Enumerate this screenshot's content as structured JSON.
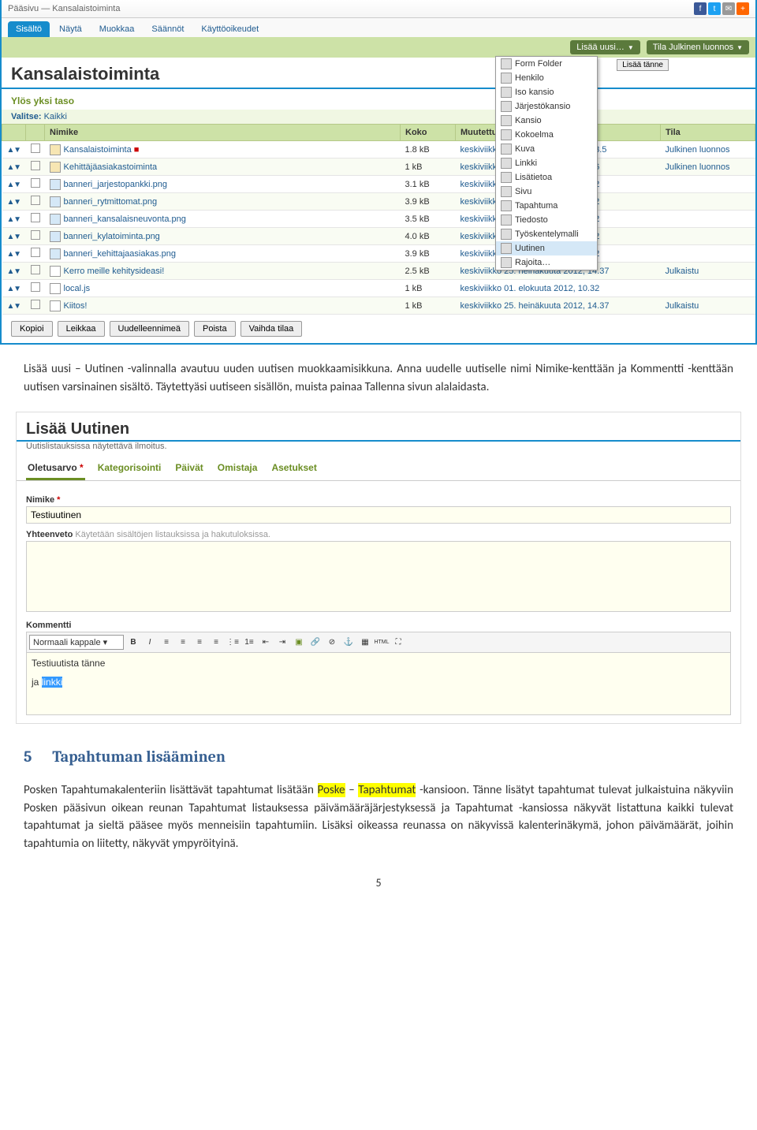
{
  "screenshot1": {
    "breadcrumb": {
      "root": "Pääsivu",
      "sep": "—",
      "current": "Kansalaistoiminta"
    },
    "tabs": [
      "Sisältö",
      "Näytä",
      "Muokkaa",
      "Säännöt",
      "Käyttöoikeudet"
    ],
    "green_buttons": {
      "add_new": "Lisää uusi…",
      "state": "Tila Julkinen luonnos"
    },
    "add_here_btn": "Lisää tänne",
    "dropdown_items": [
      {
        "icon": "form-icon",
        "label": "Form Folder"
      },
      {
        "icon": "person-icon",
        "label": "Henkilo"
      },
      {
        "icon": "folder-icon",
        "label": "Iso kansio"
      },
      {
        "icon": "folder-icon",
        "label": "Järjestökansio"
      },
      {
        "icon": "folder-icon",
        "label": "Kansio"
      },
      {
        "icon": "collection-icon",
        "label": "Kokoelma"
      },
      {
        "icon": "image-icon",
        "label": "Kuva"
      },
      {
        "icon": "link-icon",
        "label": "Linkki"
      },
      {
        "icon": "info-icon",
        "label": "Lisätietoa"
      },
      {
        "icon": "page-icon",
        "label": "Sivu"
      },
      {
        "icon": "event-icon",
        "label": "Tapahtuma"
      },
      {
        "icon": "file-icon",
        "label": "Tiedosto"
      },
      {
        "icon": "template-icon",
        "label": "Työskentelymalli"
      },
      {
        "icon": "news-icon",
        "label": "Uutinen",
        "selected": true
      },
      {
        "icon": "",
        "label": "Rajoita…"
      }
    ],
    "page_title": "Kansalaistoiminta",
    "up_link": "Ylös yksi taso",
    "select_label": "Valitse:",
    "select_all": "Kaikki",
    "columns": {
      "name": "Nimike",
      "size": "Koko",
      "modified": "Muutettu",
      "state": "Tila"
    },
    "rows": [
      {
        "icon": "folder",
        "name": "Kansalaistoiminta",
        "mark": "■",
        "size": "1.8 kB",
        "modified": "keskiviikko 09. tammikuuta 2013, 13.5",
        "state": "Julkinen luonnos"
      },
      {
        "icon": "folder",
        "name": "Kehittäjäasiakastoiminta",
        "size": "1 kB",
        "modified": "keskiviikko 29. elokuuta 2012, 14.16",
        "state": "Julkinen luonnos"
      },
      {
        "icon": "img",
        "name": "banneri_jarjestopankki.png",
        "size": "3.1 kB",
        "modified": "keskiviikko 01. elokuuta 2012, 10.32",
        "state": ""
      },
      {
        "icon": "img",
        "name": "banneri_rytmittomat.png",
        "size": "3.9 kB",
        "modified": "keskiviikko 01. elokuuta 2012, 10.32",
        "state": ""
      },
      {
        "icon": "img",
        "name": "banneri_kansalaisneuvonta.png",
        "size": "3.5 kB",
        "modified": "keskiviikko 01. elokuuta 2012, 10.32",
        "state": ""
      },
      {
        "icon": "img",
        "name": "banneri_kylatoiminta.png",
        "size": "4.0 kB",
        "modified": "keskiviikko 01. elokuuta 2012, 10.32",
        "state": ""
      },
      {
        "icon": "img",
        "name": "banneri_kehittajaasiakas.png",
        "size": "3.9 kB",
        "modified": "keskiviikko 01. elokuuta 2012, 10.32",
        "state": ""
      },
      {
        "icon": "doc",
        "name": "Kerro meille kehitysideasi!",
        "size": "2.5 kB",
        "modified": "keskiviikko 25. heinäkuuta 2012, 14.37",
        "state": "Julkaistu"
      },
      {
        "icon": "js",
        "name": "local.js",
        "size": "1 kB",
        "modified": "keskiviikko 01. elokuuta 2012, 10.32",
        "state": ""
      },
      {
        "icon": "doc",
        "name": "Kiitos!",
        "size": "1 kB",
        "modified": "keskiviikko 25. heinäkuuta 2012, 14.37",
        "state": "Julkaistu"
      }
    ],
    "actions": [
      "Kopioi",
      "Leikkaa",
      "Uudelleennimeä",
      "Poista",
      "Vaihda tilaa"
    ]
  },
  "para1": "Lisää uusi – Uutinen -valinnalla avautuu uuden uutisen muokkaamisikkuna. Anna uudelle uutiselle nimi Nimike-kenttään ja Kommentti -kenttään uutisen varsinainen sisältö. Täytettyäsi uutiseen sisällön, muista painaa Tallenna sivun alalaidasta.",
  "screenshot2": {
    "title": "Lisää Uutinen",
    "subtitle": "Uutislistauksissa näytettävä ilmoitus.",
    "tabs": [
      "Oletusarvo",
      "Kategorisointi",
      "Päivät",
      "Omistaja",
      "Asetukset"
    ],
    "nimike_label": "Nimike",
    "nimike_value": "Testiuutinen",
    "yhteenveto_label": "Yhteenveto",
    "yhteenveto_help": "Käytetään sisältöjen listauksissa ja hakutuloksissa.",
    "kommentti_label": "Kommentti",
    "rte_style_select": "Normaali kappale",
    "rte_content_line1": "Testiuutista tänne",
    "rte_content_prefix": "ja ",
    "rte_content_selected": "linkki"
  },
  "section5": {
    "num": "5",
    "title": "Tapahtuman lisääminen"
  },
  "para2_a": "Posken Tapahtumakalenteriin lisättävät tapahtumat lisätään ",
  "para2_hl1": "Poske",
  "para2_b": " – ",
  "para2_hl2": "Tapahtumat",
  "para2_c": " -kansioon. Tänne lisätyt tapahtumat tulevat julkaistuina näkyviin Posken pääsivun oikean reunan Tapahtumat listauksessa päivämääräjärjestyksessä ja Tapahtumat -kansiossa näkyvät listattuna kaikki tulevat tapahtumat ja sieltä pääsee myös menneisiin tapahtumiin. Lisäksi oikeassa reunassa on näkyvissä kalenterinäkymä, johon päivämäärät, joihin tapahtumia on liitetty, näkyvät ympyröityinä.",
  "page_num": "5"
}
